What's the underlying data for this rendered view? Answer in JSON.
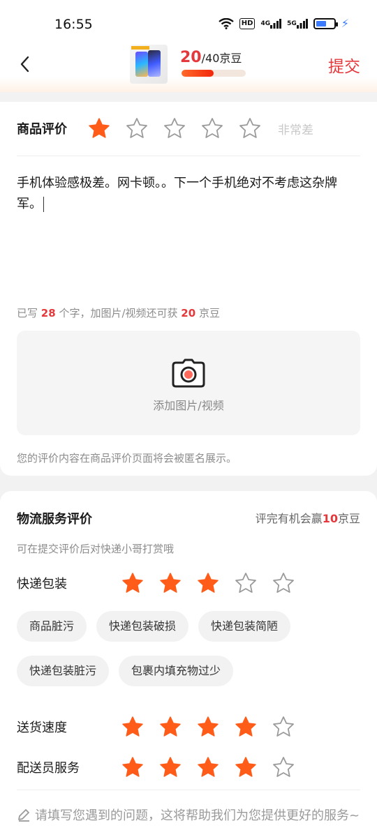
{
  "status_bar": {
    "time": "16:55",
    "hd_label": "HD",
    "net1": "4G",
    "net2": "5G"
  },
  "header": {
    "beans_current": "20",
    "beans_total": "/40京豆",
    "beans_progress_fraction": 0.5,
    "submit_label": "提交"
  },
  "product_rating": {
    "title": "商品评价",
    "stars_filled": 1,
    "stars_total": 5,
    "rating_text": "非常差",
    "review_text": "手机体验感极差。网卡顿。。下一个手机绝对不考虑这杂牌军。",
    "count_prefix": "已写",
    "count_chars": "28",
    "count_middle": "个字，加图片/视频还可获",
    "count_beans": "20",
    "count_suffix": "京豆",
    "upload_label": "添加图片/视频",
    "anonymous_note": "您的评价内容在商品评价页面将会被匿名展示。"
  },
  "logistics": {
    "title": "物流服务评价",
    "promo_prefix": "评完有机会赢",
    "promo_num": "10",
    "promo_suffix": "京豆",
    "subtitle": "可在提交评价后对快递小哥打赏哦",
    "rows": [
      {
        "name": "快递包装",
        "filled": 3
      },
      {
        "name": "送货速度",
        "filled": 4
      },
      {
        "name": "配送员服务",
        "filled": 4
      }
    ],
    "tags": [
      "商品脏污",
      "快递包装破损",
      "快递包装简陋",
      "快递包装脏污",
      "包裹内填充物过少"
    ],
    "problem_placeholder": "请填写您遇到的问题，这将帮助我们为您提供更好的服务~"
  },
  "colors": {
    "accent_red": "#e4393c",
    "star_orange": "#ff5c1a",
    "star_empty": "#c0c0c0"
  }
}
